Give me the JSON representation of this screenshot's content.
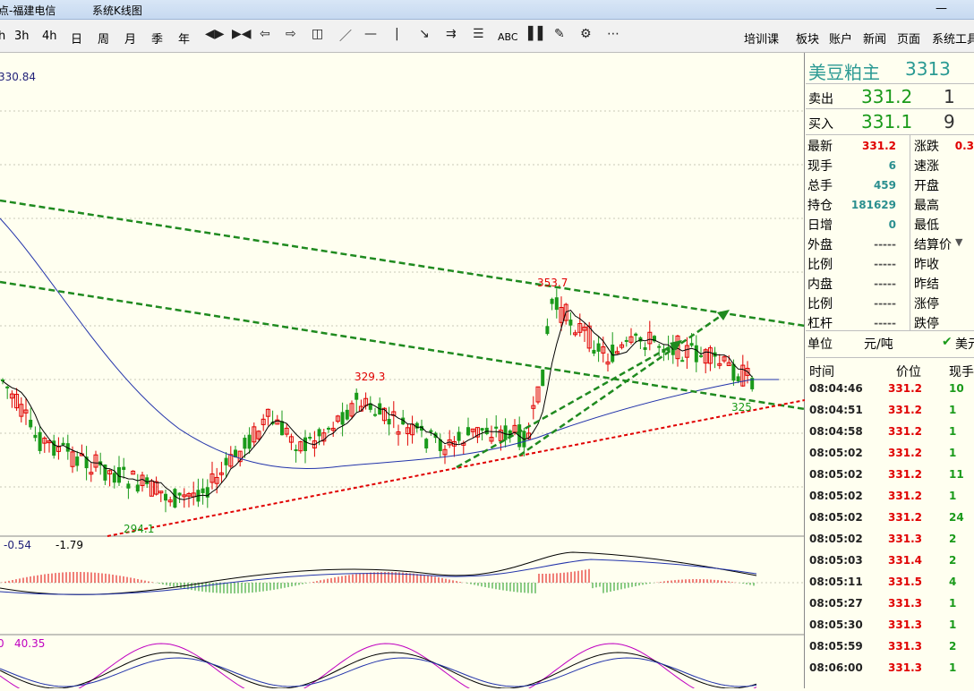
{
  "titlebar": {
    "left": "点-福建电信",
    "right": "系统K线图"
  },
  "toolbar": {
    "periods": [
      "3h",
      "4h",
      "日",
      "周",
      "月",
      "季",
      "年"
    ],
    "first_period": "h",
    "abc": "ABC",
    "more": "⋯",
    "right_menu": [
      "培训课",
      "板块",
      "账户",
      "新闻",
      "页面",
      "系统工具"
    ]
  },
  "chart": {
    "top_price": "330.84",
    "macd_values": [
      "-0.54",
      "-1.79"
    ],
    "kdj_values": [
      "0",
      "40.35"
    ],
    "annotations": {
      "high": "353.7",
      "peak2": "329.3",
      "low": "294.1",
      "last_low": "325"
    },
    "colors": {
      "up": "#e00000",
      "down": "#1a9a1a",
      "trend_green": "#1f8a1f",
      "trend_red": "#e00000",
      "ma_blue": "#2233aa"
    }
  },
  "quote": {
    "name": "美豆粕主",
    "code": "3313",
    "sell_label": "卖出",
    "sell_price": "331.2",
    "sell_vol": "1",
    "buy_label": "买入",
    "buy_price": "331.1",
    "buy_vol": "9",
    "left_rows": [
      {
        "label": "最新",
        "value": "331.2",
        "color": "#e00000"
      },
      {
        "label": "现手",
        "value": "6",
        "color": "#2b8f8f"
      },
      {
        "label": "总手",
        "value": "459",
        "color": "#2b8f8f"
      },
      {
        "label": "持仓",
        "value": "181629",
        "color": "#2b8f8f"
      },
      {
        "label": "日增",
        "value": "0",
        "color": "#2b8f8f"
      },
      {
        "label": "外盘",
        "value": "-----",
        "color": "#555"
      },
      {
        "label": "比例",
        "value": "-----",
        "color": "#555"
      },
      {
        "label": "内盘",
        "value": "-----",
        "color": "#555"
      },
      {
        "label": "比例",
        "value": "-----",
        "color": "#555"
      },
      {
        "label": "杠杆",
        "value": "-----",
        "color": "#555"
      }
    ],
    "right_labels": [
      "涨跌",
      "速涨",
      "开盘",
      "最高",
      "最低",
      "结算价",
      "昨收",
      "昨结",
      "涨停",
      "跌停"
    ],
    "change_partial": "0.3",
    "unit_label": "单位",
    "unit_value": "元/吨",
    "currency_partial": "美元",
    "trades_header": {
      "time": "时间",
      "price": "价位",
      "vol": "现手"
    },
    "trades": [
      {
        "time": "08:04:46",
        "price": "331.2",
        "vol": "10"
      },
      {
        "time": "08:04:51",
        "price": "331.2",
        "vol": "1"
      },
      {
        "time": "08:04:58",
        "price": "331.2",
        "vol": "1"
      },
      {
        "time": "08:05:02",
        "price": "331.2",
        "vol": "1"
      },
      {
        "time": "08:05:02",
        "price": "331.2",
        "vol": "11"
      },
      {
        "time": "08:05:02",
        "price": "331.2",
        "vol": "1"
      },
      {
        "time": "08:05:02",
        "price": "331.2",
        "vol": "24"
      },
      {
        "time": "08:05:02",
        "price": "331.3",
        "vol": "2"
      },
      {
        "time": "08:05:03",
        "price": "331.4",
        "vol": "2"
      },
      {
        "time": "08:05:11",
        "price": "331.5",
        "vol": "4"
      },
      {
        "time": "08:05:27",
        "price": "331.3",
        "vol": "1"
      },
      {
        "time": "08:05:30",
        "price": "331.3",
        "vol": "1"
      },
      {
        "time": "08:05:59",
        "price": "331.3",
        "vol": "2"
      },
      {
        "time": "08:06:00",
        "price": "331.3",
        "vol": "1"
      }
    ]
  }
}
